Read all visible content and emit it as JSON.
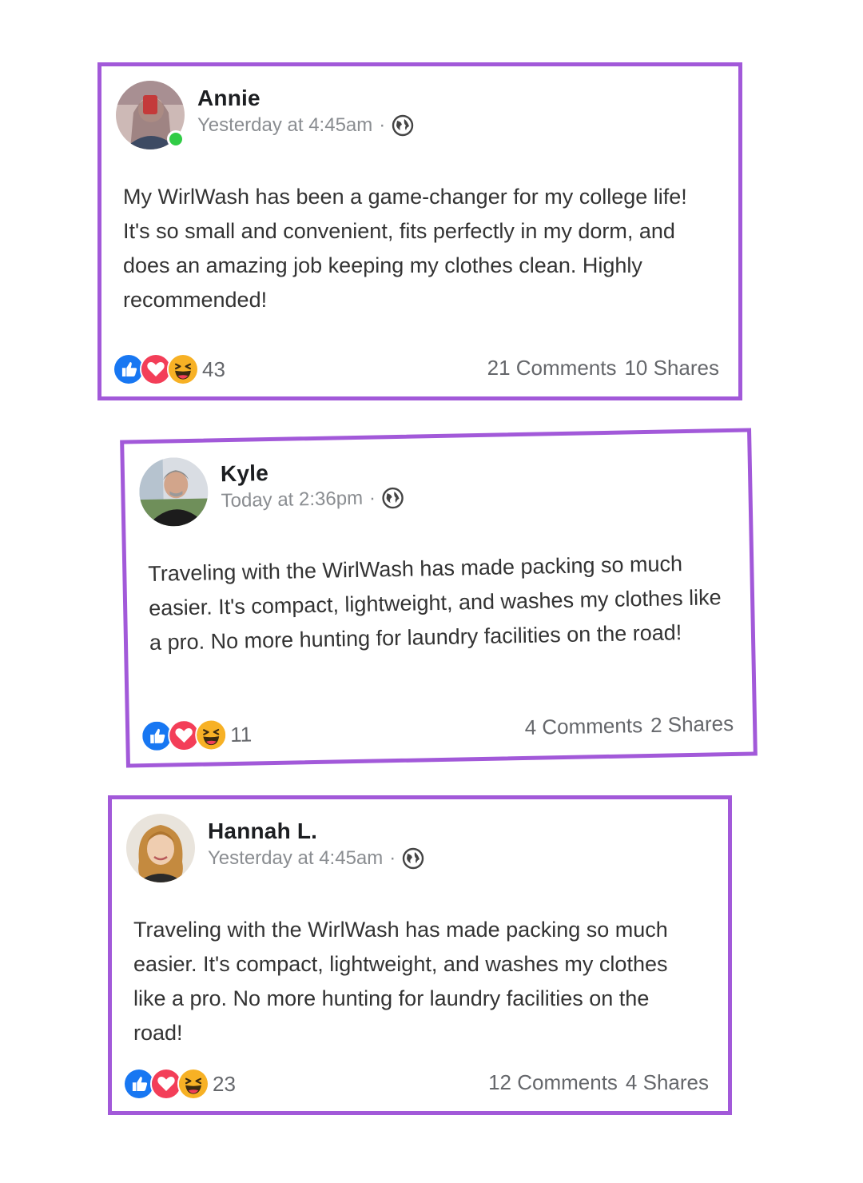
{
  "posts": [
    {
      "author": "Annie",
      "timestamp": "Yesterday at 4:45am",
      "separator": "·",
      "privacy_icon": "globe-icon",
      "online": true,
      "body": "My WirlWash has been a game-changer for my college life! It's so small and convenient, fits perfectly in my dorm, and does an amazing job keeping my clothes clean. Highly recommended!",
      "reactions": [
        "like-icon",
        "love-icon",
        "haha-icon"
      ],
      "reaction_count": "43",
      "comments": "21 Comments",
      "shares": "10 Shares"
    },
    {
      "author": "Kyle",
      "timestamp": "Today at 2:36pm",
      "separator": "·",
      "privacy_icon": "globe-icon",
      "online": false,
      "body": "Traveling with the WirlWash has made packing so much easier. It's compact, lightweight, and washes my clothes like a pro. No more hunting for laundry facilities on the road!",
      "reactions": [
        "like-icon",
        "love-icon",
        "haha-icon"
      ],
      "reaction_count": "11",
      "comments": "4 Comments",
      "shares": "2 Shares"
    },
    {
      "author": "Hannah L.",
      "timestamp": "Yesterday at 4:45am",
      "separator": "·",
      "privacy_icon": "globe-icon",
      "online": false,
      "body": "Traveling with the WirlWash has made packing so much easier. It's compact, lightweight, and washes my clothes like a pro. No more hunting for laundry facilities on the road!",
      "reactions": [
        "like-icon",
        "love-icon",
        "haha-icon"
      ],
      "reaction_count": "23",
      "comments": "12 Comments",
      "shares": "4 Shares"
    }
  ],
  "colors": {
    "card_border": "#a259d9",
    "like": "#1877f2",
    "love": "#f33e58",
    "haha": "#f7b125",
    "online": "#31cc46",
    "muted_text": "#65676b"
  }
}
